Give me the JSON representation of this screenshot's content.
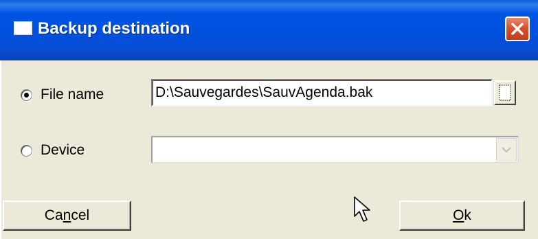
{
  "window": {
    "title": "Backup destination"
  },
  "options": {
    "file_name": {
      "label": "File name",
      "selected": true,
      "value": "D:\\Sauvegardes\\SauvAgenda.bak"
    },
    "device": {
      "label": "Device",
      "selected": false,
      "value": ""
    }
  },
  "buttons": {
    "cancel": {
      "before": "Ca",
      "mnemonic": "n",
      "after": "cel"
    },
    "ok": {
      "before": "",
      "mnemonic": "O",
      "after": "k"
    }
  },
  "icons": {
    "title": "window-icon",
    "close": "close-icon",
    "browse": "browse-file-icon",
    "dropdown": "chevron-down-icon",
    "cursor": "mouse-pointer-icon"
  },
  "colors": {
    "titlebar": "#0054e3",
    "close_button": "#d8522e",
    "dialog_background": "#ece9d8"
  }
}
